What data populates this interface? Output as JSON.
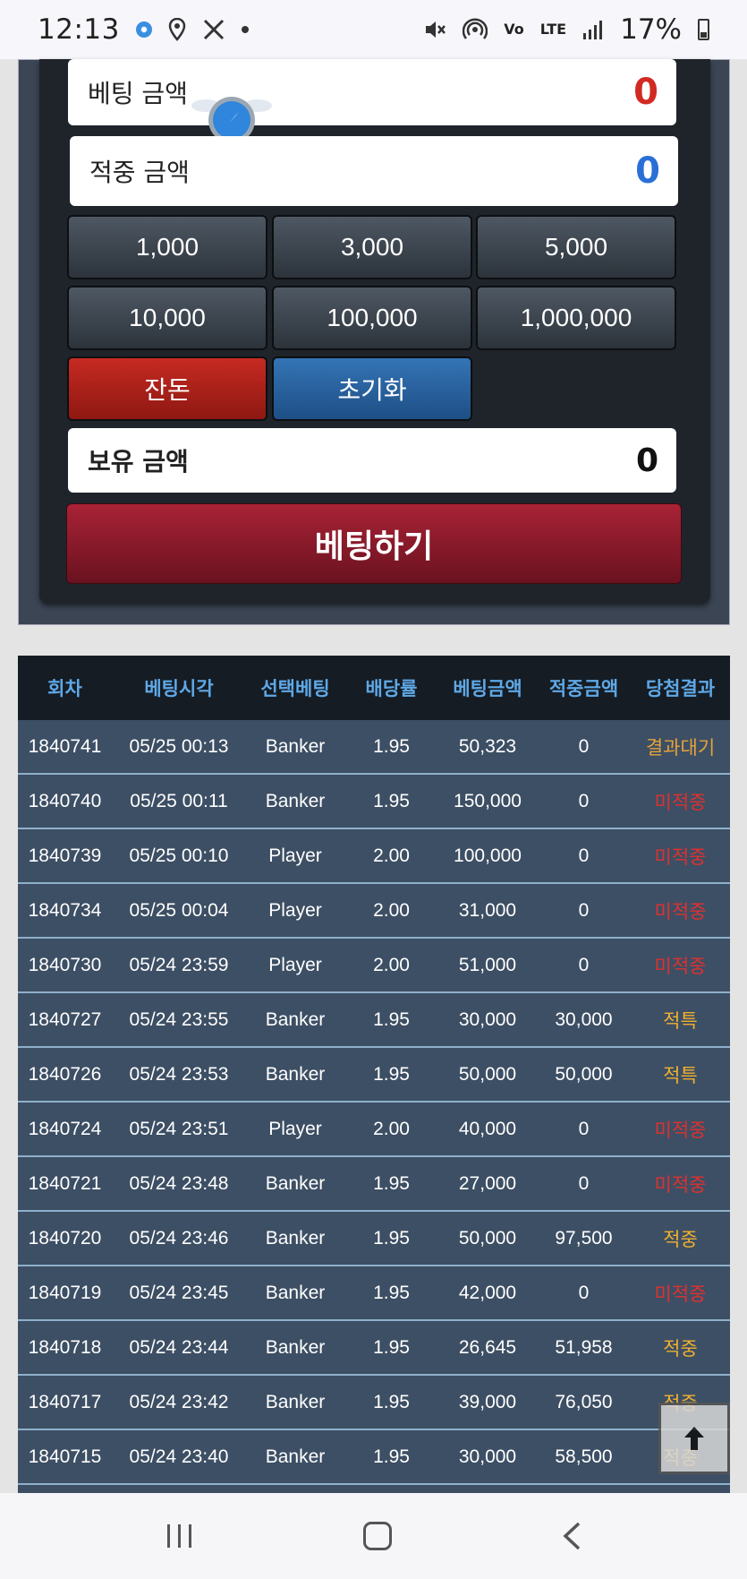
{
  "status_bar": {
    "time": "12:13",
    "icons_left": [
      "app-icon",
      "location-icon",
      "tools-icon",
      "dot-icon"
    ],
    "icons_right": [
      "mute-icon",
      "hotspot-icon",
      "volte-icon",
      "lte-icon",
      "signal-icon"
    ],
    "volte_label": "Vo",
    "lte_label": "LTE",
    "battery": "17%"
  },
  "bet_form": {
    "bet_amount_label": "베팅 금액",
    "bet_amount_value": "0",
    "win_amount_label": "적중 금액",
    "win_amount_value": "0",
    "amount_buttons": [
      "1,000",
      "3,000",
      "5,000",
      "10,000",
      "100,000",
      "1,000,000"
    ],
    "remainder_label": "잔돈",
    "reset_label": "초기화",
    "balance_label": "보유 금액",
    "balance_value": "0",
    "bet_button_label": "베팅하기"
  },
  "colors": {
    "bet_amount": "#d12a22",
    "win_amount": "#2a6fd6",
    "header_text": "#5fa8e6",
    "pending": "#e6a23c",
    "lose": "#e03030",
    "win": "#f0b030"
  },
  "table": {
    "headers": [
      "회차",
      "베팅시각",
      "선택베팅",
      "배당률",
      "베팅금액",
      "적중금액",
      "당첨결과"
    ],
    "rows": [
      {
        "round": "1840741",
        "time": "05/25 00:13",
        "choice": "Banker",
        "odds": "1.95",
        "bet": "50,323",
        "win": "0",
        "result": "결과대기",
        "result_type": "pending"
      },
      {
        "round": "1840740",
        "time": "05/25 00:11",
        "choice": "Banker",
        "odds": "1.95",
        "bet": "150,000",
        "win": "0",
        "result": "미적중",
        "result_type": "lose"
      },
      {
        "round": "1840739",
        "time": "05/25 00:10",
        "choice": "Player",
        "odds": "2.00",
        "bet": "100,000",
        "win": "0",
        "result": "미적중",
        "result_type": "lose"
      },
      {
        "round": "1840734",
        "time": "05/25 00:04",
        "choice": "Player",
        "odds": "2.00",
        "bet": "31,000",
        "win": "0",
        "result": "미적중",
        "result_type": "lose"
      },
      {
        "round": "1840730",
        "time": "05/24 23:59",
        "choice": "Player",
        "odds": "2.00",
        "bet": "51,000",
        "win": "0",
        "result": "미적중",
        "result_type": "lose"
      },
      {
        "round": "1840727",
        "time": "05/24 23:55",
        "choice": "Banker",
        "odds": "1.95",
        "bet": "30,000",
        "win": "30,000",
        "result": "적특",
        "result_type": "win"
      },
      {
        "round": "1840726",
        "time": "05/24 23:53",
        "choice": "Banker",
        "odds": "1.95",
        "bet": "50,000",
        "win": "50,000",
        "result": "적특",
        "result_type": "win"
      },
      {
        "round": "1840724",
        "time": "05/24 23:51",
        "choice": "Player",
        "odds": "2.00",
        "bet": "40,000",
        "win": "0",
        "result": "미적중",
        "result_type": "lose"
      },
      {
        "round": "1840721",
        "time": "05/24 23:48",
        "choice": "Banker",
        "odds": "1.95",
        "bet": "27,000",
        "win": "0",
        "result": "미적중",
        "result_type": "lose"
      },
      {
        "round": "1840720",
        "time": "05/24 23:46",
        "choice": "Banker",
        "odds": "1.95",
        "bet": "50,000",
        "win": "97,500",
        "result": "적중",
        "result_type": "win"
      },
      {
        "round": "1840719",
        "time": "05/24 23:45",
        "choice": "Banker",
        "odds": "1.95",
        "bet": "42,000",
        "win": "0",
        "result": "미적중",
        "result_type": "lose"
      },
      {
        "round": "1840718",
        "time": "05/24 23:44",
        "choice": "Banker",
        "odds": "1.95",
        "bet": "26,645",
        "win": "51,958",
        "result": "적중",
        "result_type": "win"
      },
      {
        "round": "1840717",
        "time": "05/24 23:42",
        "choice": "Banker",
        "odds": "1.95",
        "bet": "39,000",
        "win": "76,050",
        "result": "적중",
        "result_type": "win"
      },
      {
        "round": "1840715",
        "time": "05/24 23:40",
        "choice": "Banker",
        "odds": "1.95",
        "bet": "30,000",
        "win": "58,500",
        "result": "적중",
        "result_type": "win"
      }
    ]
  },
  "scroll_top_icon": "arrow-up-icon",
  "nav_bar": {
    "items": [
      "recent-apps-icon",
      "home-icon",
      "back-icon"
    ]
  }
}
